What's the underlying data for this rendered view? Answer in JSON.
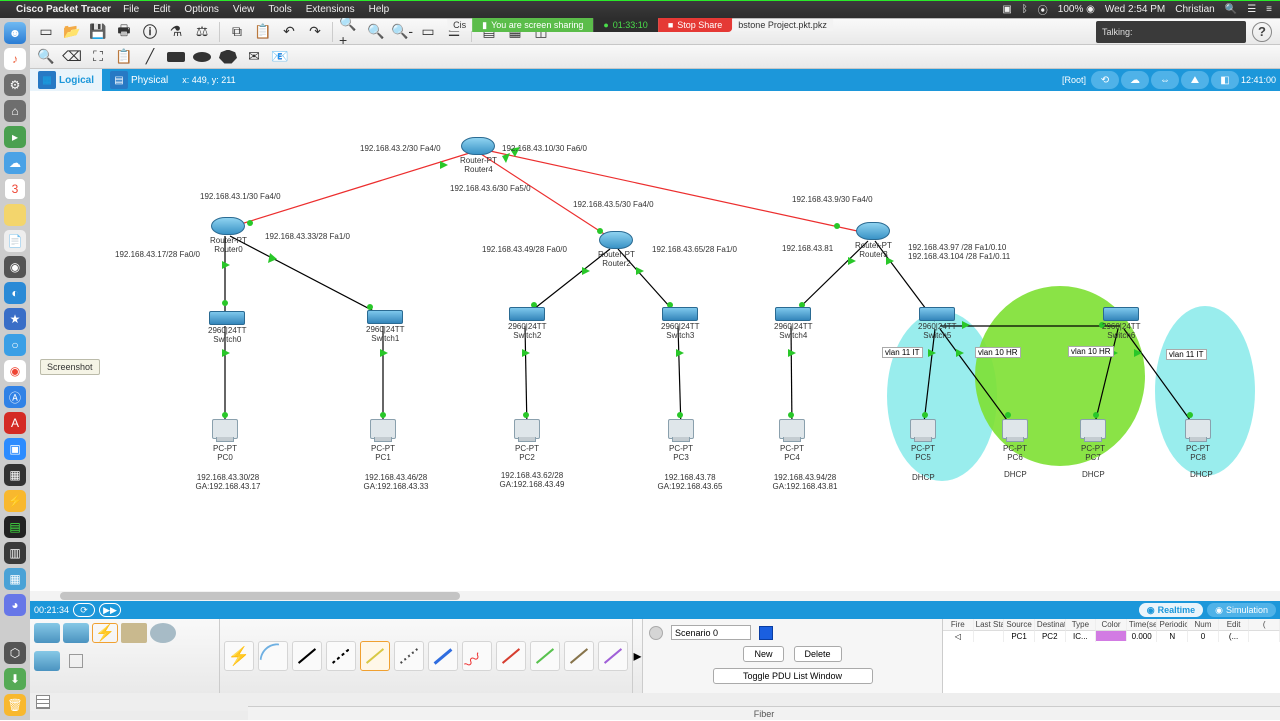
{
  "mac_menu": {
    "app": "Cisco Packet Tracer",
    "items": [
      "File",
      "Edit",
      "Options",
      "View",
      "Tools",
      "Extensions",
      "Help"
    ],
    "right": {
      "battery": "100%",
      "daytime": "Wed 2:54 PM",
      "user": "Christian"
    }
  },
  "sharebar": {
    "left_tab": "Cis",
    "sharing": "You are screen sharing",
    "timer": "01:33:10",
    "stop": "Stop Share",
    "right_tab": "bstone Project.pkt.pkz"
  },
  "talking_label": "Talking:",
  "viewbar": {
    "logical": "Logical",
    "physical": "Physical",
    "coords": "x: 449, y: 211",
    "root": "[Root]",
    "clock": "12:41:00"
  },
  "tooltip": "Screenshot",
  "statusbar": {
    "timer": "00:21:34",
    "realtime": "Realtime",
    "simulation": "Simulation"
  },
  "scenario": {
    "label": "Scenario 0",
    "new": "New",
    "delete": "Delete",
    "toggle": "Toggle PDU List Window"
  },
  "pdu": {
    "headers": [
      "Fire",
      "Last Status",
      "Source",
      "Destination",
      "Type",
      "Color",
      "Time(sec)",
      "Periodic",
      "Num",
      "Edit",
      "("
    ],
    "row": {
      "source": "PC1",
      "dest": "PC2",
      "type": "IC...",
      "time": "0.000",
      "periodic": "N",
      "num": "0",
      "edit": "(..."
    }
  },
  "bottom_label": "Fiber",
  "labels": {
    "r4_ip_l": "192.168.43.2/30 Fa4/0",
    "r4_ip_r": "192.168.43.10/30 Fa6/0",
    "r4_ip_b": "192.168.43.6/30 Fa5/0",
    "r0_ip_t": "192.168.43.1/30 Fa4/0",
    "r0_ip_l": "192.168.43.17/28 Fa0/0",
    "r0_ip_r": "192.168.43.33/28 Fa1/0",
    "r2_ip_t": "192.168.43.5/30 Fa4/0",
    "r2_ip_l": "192.168.43.49/28 Fa0/0",
    "r2_ip_r": "192.168.43.65/28 Fa1/0",
    "r3_ip_t": "192.168.43.9/30 Fa4/0",
    "r3_ip_l": "192.168.43.81",
    "r3_ip_r1": "192.168.43.97 /28 Fa1/0.10",
    "r3_ip_r2": "192.168.43.104 /28 Fa1/0.11",
    "sw0": "2960|24TT",
    "sw0n": "Switch0",
    "sw1": "2960|24TT",
    "sw1n": "Switch1",
    "sw2": "2960|24TT",
    "sw2n": "Switch2",
    "sw3": "2960|24TT",
    "sw3n": "Switch3",
    "sw4": "2960|24TT",
    "sw4n": "Switch4",
    "sw5": "2960|24TT",
    "sw5n": "Switch5",
    "sw6": "2960|24TT",
    "sw6n": "Switch6",
    "pc0": "PC-PT",
    "pc0n": "PC0",
    "pc1": "PC-PT",
    "pc1n": "PC1",
    "pc2": "PC-PT",
    "pc2n": "PC2",
    "pc3": "PC-PT",
    "pc3n": "PC3",
    "pc4": "PC-PT",
    "pc4n": "PC4",
    "pc5": "PC-PT",
    "pc5n": "PC5",
    "pc6": "PC-PT",
    "pc6n": "PC6",
    "pc7": "PC-PT",
    "pc7n": "PC7",
    "pc8": "PC-PT",
    "pc8n": "PC8",
    "r4": "Router-PT",
    "r4n": "Router4",
    "r0": "Router-PT",
    "r0n": "Router0",
    "r2": "Router-PT",
    "r2n": "Router2",
    "r3": "Router-PT",
    "r3n": "Router3",
    "pc0ip": "192.168.43.30/28",
    "pc0gw": "GA:192.168.43.17",
    "pc1ip": "192.168.43.46/28",
    "pc1gw": "GA:192.168.43.33",
    "pc2ip": "192.168.43.62/28",
    "pc2gw": "GA:192.168.43.49",
    "pc3ip": "192.168.43.78",
    "pc3gw": "GA:192.168.43.65",
    "pc4ip": "192.168.43.94/28",
    "pc4gw": "GA:192.168.43.81",
    "dhcp": "DHCP",
    "v11": "vlan 11 IT",
    "v10": "vlan 10 HR"
  }
}
